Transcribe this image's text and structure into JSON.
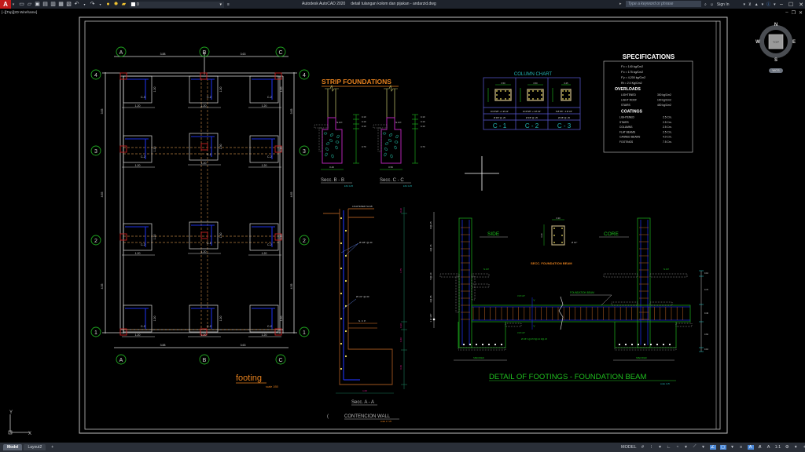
{
  "titlebar": {
    "app_icon": "autocad-logo-icon",
    "app_letter": "A",
    "quick_access_icons": [
      "new-icon",
      "open-icon",
      "save-icon",
      "save-as-icon",
      "plot-preview-icon",
      "publish-icon",
      "print-icon",
      "undo-icon",
      "redo-icon"
    ],
    "layer_icons": [
      "lightbulb-icon",
      "sun-icon",
      "lock-icon"
    ],
    "current_layer": "0",
    "title": "Autodesk AutoCAD 2020",
    "filename": "detail tulangan kolom dan pijakan - andarzid.dwg",
    "search_placeholder": "Type a keyword or phrase",
    "sign_in": "Sign In",
    "help": "?"
  },
  "viewport": {
    "label": "[−][Top][2D Wireframe]"
  },
  "viewcube": {
    "face": "TOP",
    "north": "N",
    "south": "S",
    "east": "E",
    "west": "W",
    "wcs": "WCS"
  },
  "ucs": {
    "x": "X",
    "y": "Y"
  },
  "drawing": {
    "footing_plan": {
      "title": "footing",
      "scale": "scale 1/50",
      "grid_letters": [
        "A",
        "B",
        "C"
      ],
      "grid_numbers": [
        "4",
        "3",
        "2",
        "1"
      ],
      "top_dims": [
        "3.88",
        "3.63"
      ],
      "bottom_dims": [
        "3.88",
        "3.63"
      ],
      "left_dims": [
        "3.65",
        "4.65",
        "4.35"
      ],
      "right_dims": [
        "3.65",
        "4.65",
        "4.35"
      ],
      "footing_size": "1.20",
      "footing_size_center": "1.50",
      "footing_labels": {
        "c1": "C-1",
        "c2": "C-2",
        "c3": "C-3"
      }
    },
    "strip_foundations": {
      "title": "STRIP FOUNDATIONS",
      "sections": [
        {
          "label": "Secc. B - B",
          "scale": "ESC 1/25",
          "width": "0.40",
          "dims": [
            "0.10",
            "0.10",
            "0.10",
            "0.70"
          ],
          "nfp": "N.F.P."
        },
        {
          "label": "Secc. C - C",
          "scale": "ESC 1/25",
          "width": "0.50",
          "dims": [
            "0.10",
            "0.10",
            "0.10",
            "0.70"
          ],
          "nfp": "N.F.P."
        }
      ]
    },
    "column_chart": {
      "title": "COLUMN CHART",
      "columns": [
        {
          "name": "C - 1",
          "size": "0.50",
          "rebar": "10 Ø 5/8\" + 4 Ø 1/2\"",
          "stirrups": "Ø 3/8\" @ .25"
        },
        {
          "name": "C - 2",
          "size": "0.50",
          "rebar": "10 Ø 5/8\" + 2 Ø 1/2\"",
          "stirrups": "Ø 3/8\" @ .25"
        },
        {
          "name": "C - 3",
          "size": "0.25",
          "rebar": "8 Ø 5/8\" - 2 Ø 1/2\"",
          "stirrups": "Ø 3/8\" @ .25"
        }
      ]
    },
    "specifications": {
      "title": "SPECIFICATIONS",
      "materials": [
        "F'c = 140 kg/Cm2",
        "F'c = 175 kg/Cm2",
        "F'y = 4,200 kg/Cm2",
        "Rt = 2.0 Kg/Cm2"
      ],
      "overloads_title": "OVERLOADS",
      "overloads": [
        {
          "item": "LIGHTENED",
          "value": "300 kg/Cm2"
        },
        {
          "item": "LIGHT ROOF",
          "value": "100 kg/Cm2"
        },
        {
          "item": "STAIRS",
          "value": "400 kg/Cm2"
        }
      ],
      "coatings_title": "COATINGS",
      "coatings": [
        {
          "item": "LIGHTENED",
          "value": "2.5 Cm."
        },
        {
          "item": "STAIRS",
          "value": "2.5 Cm."
        },
        {
          "item": "COLUMNS",
          "value": "2.5 Cm."
        },
        {
          "item": "FLAT BEAMS",
          "value": "2.5 Cm."
        },
        {
          "item": "CANNED BEAMS",
          "value": "4.0 Cm."
        },
        {
          "item": "FOOTINGS",
          "value": "7.5 Cm."
        }
      ]
    },
    "retaining_wall": {
      "slab_label": "LIGHTENED SLAB",
      "rebar1": "Ø 3/8\" @.40",
      "rebar2": "Ø 1/2\" @.30",
      "nfp": "N. F. P.",
      "section": "Secc. A - A",
      "title": "CONTENCION WALL",
      "scale": "scale 1:7.25",
      "base_width": "1.00",
      "dims": [
        "0.20",
        "1.75",
        "0.20",
        "0.40",
        "0.60"
      ]
    },
    "foundation_beam": {
      "side": "SIDE",
      "core": "CORE",
      "section_title": "SECC. FOUNDATION BEAM",
      "section_w": "0.30",
      "section_h": "0.40",
      "section_rebar": "Ø 1/2\"",
      "beam_label": "FOUNDATION BEAM",
      "rebar_top": "3 Ø 1/2\"",
      "rebar_bot": "3 Ø 1/2\"",
      "stirrups": "Ø 3/8\" 1@.05 5@.10 R@.25",
      "nfp": "N.F.P.",
      "specified": "SPECIFIED",
      "title": "DETAIL OF FOOTINGS - FOUNDATION BEAM",
      "scale": "scale 1:25",
      "left_dims": [
        "1 Ø 3/8\"",
        "2@.05",
        "5@.10",
        "2@.15",
        "R@.25"
      ],
      "right_dims": [
        "0.10",
        "0.70",
        "0.40",
        "0.60",
        "0.10"
      ],
      "y_marker": "Y"
    }
  },
  "statusbar": {
    "tabs": [
      "Model",
      "Layout2",
      "+"
    ],
    "model_label": "MODEL",
    "scale": "1:1",
    "icons": [
      "grid-icon",
      "snap-icon",
      "ortho-icon",
      "polar-icon",
      "isodraft-icon",
      "osnap-icon",
      "otrack-icon",
      "lineweight-icon",
      "transparency-icon",
      "annotation-icon",
      "autoscale-icon",
      "annotation-scale-icon",
      "workspace-icon",
      "plus-icon",
      "units-icon",
      "isolate-icon",
      "fullscreen-icon",
      "customize-icon"
    ]
  }
}
